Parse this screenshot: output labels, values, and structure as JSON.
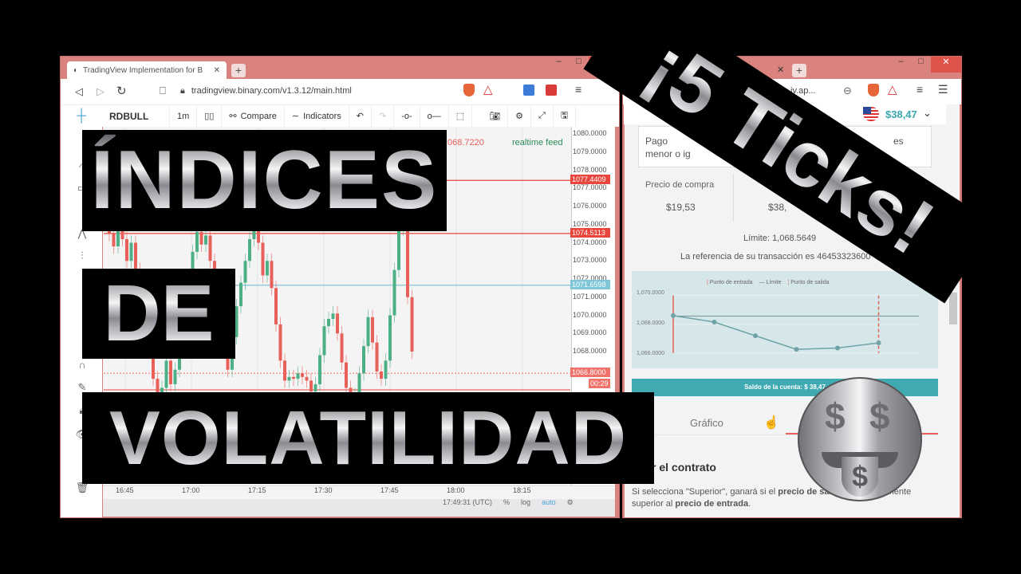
{
  "left_browser": {
    "tab_title": "TradingView Implementation for B",
    "url": "tradingview.binary.com/v1.3.12/main.html",
    "toolbar": {
      "symbol": "RDBULL",
      "interval": "1m",
      "compare": "Compare",
      "indicators": "Indicators"
    },
    "legend_price": "068.7220",
    "feed_status": "realtime feed",
    "y_ticks": [
      "1080.0000",
      "1079.0000",
      "1078.0000",
      "1077.0000",
      "1076.0000",
      "1075.0000",
      "1074.0000",
      "1073.0000",
      "1072.0000",
      "1071.0000",
      "1070.0000",
      "1069.0000",
      "1068.0000"
    ],
    "price_tags": [
      {
        "label": "1077.4409",
        "value": 1077.4409,
        "color": "#e8453c"
      },
      {
        "label": "1074.5113",
        "value": 1074.5113,
        "color": "#e8453c"
      },
      {
        "label": "1071.6598",
        "value": 1071.6598,
        "color": "#7fc6d8"
      },
      {
        "label": "1066.8000",
        "value": 1066.8,
        "color": "#f0726a"
      },
      {
        "label": "00:29",
        "value": 1066.2,
        "color": "#f0726a"
      }
    ],
    "x_ticks": [
      "16:45",
      "17:00",
      "17:15",
      "17:30",
      "17:45",
      "18:00",
      "18:15"
    ],
    "status_bar": {
      "time": "17:49:31 (UTC)",
      "percent": "%",
      "log": "log",
      "auto": "auto"
    },
    "candles": {
      "start": "16:41",
      "interval": "1m",
      "up_color": "#4caf86",
      "down_color": "#e8605a",
      "closes": [
        1074.5,
        1073.8,
        1074.9,
        1074.2,
        1073.0,
        1074.0,
        1072.5,
        1071.0,
        1069.5,
        1068.0,
        1066.5,
        1065.2,
        1066.0,
        1067.5,
        1066.2,
        1067.0,
        1069.0,
        1070.5,
        1072.0,
        1073.5,
        1074.6,
        1073.9,
        1074.4,
        1073.0,
        1071.5,
        1070.0,
        1068.5,
        1067.0,
        1068.8,
        1070.5,
        1071.8,
        1073.0,
        1074.2,
        1075.0,
        1074.0,
        1072.2,
        1073.0,
        1071.5,
        1069.5,
        1067.5,
        1066.4,
        1066.6,
        1066.5,
        1066.8,
        1066.6,
        1066.4,
        1065.8,
        1066.2,
        1067.8,
        1069.4,
        1069.8,
        1070.1,
        1069.0,
        1067.4,
        1066.0,
        1065.4,
        1065.6,
        1066.8,
        1068.3,
        1069.9,
        1068.5,
        1066.9,
        1066.5,
        1067.5,
        1070.0,
        1072.5,
        1074.8,
        1075.0,
        1071.0,
        1068.0
      ]
    }
  },
  "right_browser": {
    "url_fragment": "iv.ap...",
    "balance": "$38,47",
    "payout_text_1": "Pago",
    "payout_text_2": "menor o ig",
    "payout_text_3": "es",
    "purchase_label": "Precio de compra",
    "purchase_value": "$19,53",
    "payout_value": "$38,",
    "limit": "Límite: 1,068.5649",
    "reference": "La referencia de su transacción es 46453323600",
    "chart": {
      "legend": [
        "Punto de entrada",
        "Límite",
        "Punto de salida"
      ],
      "y_ticks": [
        "1,070.0000",
        "1,068.0000",
        "1,066.0000"
      ],
      "ylim": [
        1065.6,
        1070.2
      ],
      "points": [
        1068.6,
        1068.15,
        1067.2,
        1066.25,
        1066.35,
        1066.7
      ],
      "limit": 1068.5649,
      "line_color": "#6fa3a8",
      "marker_color": "#e8605a"
    },
    "account_bar": "Saldo de la cuenta: $ 38,47",
    "tab_chart": "Gráfico",
    "heading": "Explicar el contrato",
    "explain_1": "Si selecciona \"Superior\", ganará si el ",
    "explain_b1": "precio de salida",
    "explain_2": " es estrictamente superior al ",
    "explain_b2": "precio de entrada",
    "explain_3": "."
  },
  "overlay": {
    "line1": "ÍNDICES",
    "line2": "DE",
    "line3": "VOLATILIDAD",
    "banner": "¡5 Ticks!",
    "emoji": "money-face-icon"
  }
}
